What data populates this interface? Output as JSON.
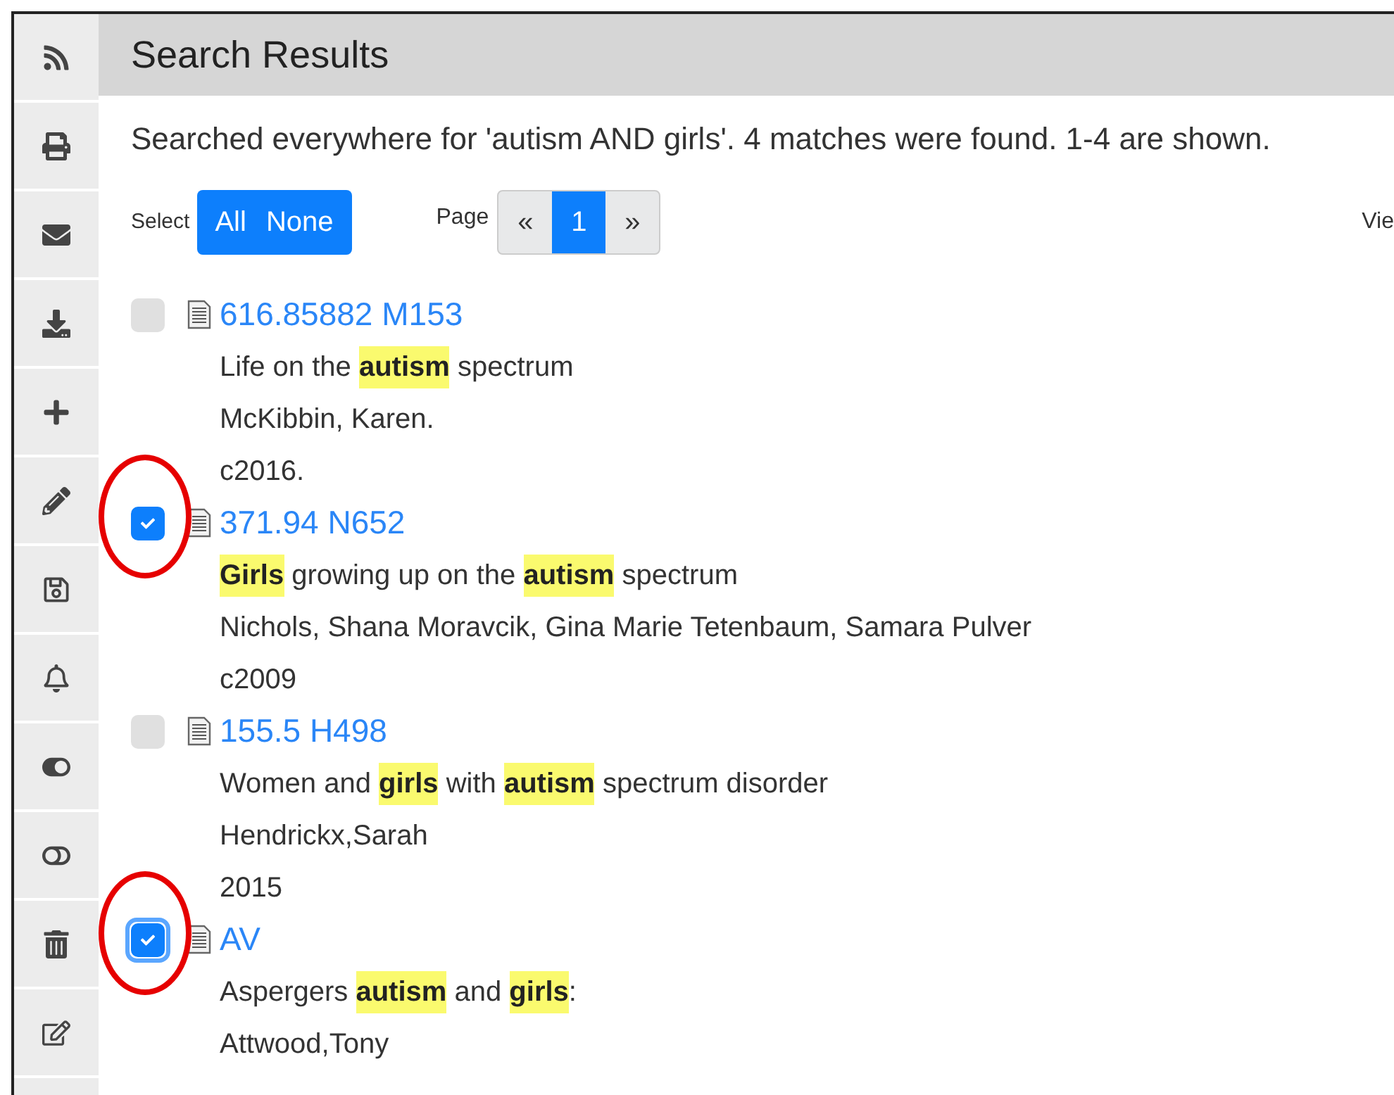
{
  "header": {
    "title": "Search Results"
  },
  "summary": "Searched everywhere for 'autism AND girls'. 4 matches were found. 1-4 are shown.",
  "select": {
    "label": "Select",
    "buttons": [
      "All",
      "None"
    ]
  },
  "pagination": {
    "label": "Page",
    "prev": "«",
    "pages": [
      {
        "label": "1",
        "selected": true
      }
    ],
    "next": "»"
  },
  "view_label": "Vie",
  "records": [
    {
      "call_number": "616.85882 M153",
      "checked": false,
      "focused": false,
      "circled": false,
      "title": [
        {
          "text": "Life on the ",
          "highlight": false
        },
        {
          "text": "autism",
          "highlight": true
        },
        {
          "text": " spectrum",
          "highlight": false
        }
      ],
      "lines": [
        "McKibbin, Karen.",
        "c2016."
      ]
    },
    {
      "call_number": "371.94 N652",
      "checked": true,
      "focused": false,
      "circled": true,
      "title": [
        {
          "text": "Girls",
          "highlight": true
        },
        {
          "text": " growing up on the ",
          "highlight": false
        },
        {
          "text": "autism",
          "highlight": true
        },
        {
          "text": " spectrum",
          "highlight": false
        }
      ],
      "lines": [
        "Nichols, Shana Moravcik, Gina Marie Tetenbaum, Samara Pulver",
        "c2009"
      ]
    },
    {
      "call_number": "155.5 H498",
      "checked": false,
      "focused": false,
      "circled": false,
      "title": [
        {
          "text": "Women and ",
          "highlight": false
        },
        {
          "text": "girls",
          "highlight": true
        },
        {
          "text": " with ",
          "highlight": false
        },
        {
          "text": "autism",
          "highlight": true
        },
        {
          "text": " spectrum disorder",
          "highlight": false
        }
      ],
      "lines": [
        "Hendrickx,Sarah",
        "2015"
      ]
    },
    {
      "call_number": "AV",
      "checked": true,
      "focused": true,
      "circled": true,
      "title": [
        {
          "text": "Aspergers ",
          "highlight": false
        },
        {
          "text": "autism",
          "highlight": true
        },
        {
          "text": " and ",
          "highlight": false
        },
        {
          "text": "girls",
          "highlight": true
        },
        {
          "text": ":",
          "highlight": false
        }
      ],
      "lines": [
        "Attwood,Tony"
      ]
    }
  ]
}
